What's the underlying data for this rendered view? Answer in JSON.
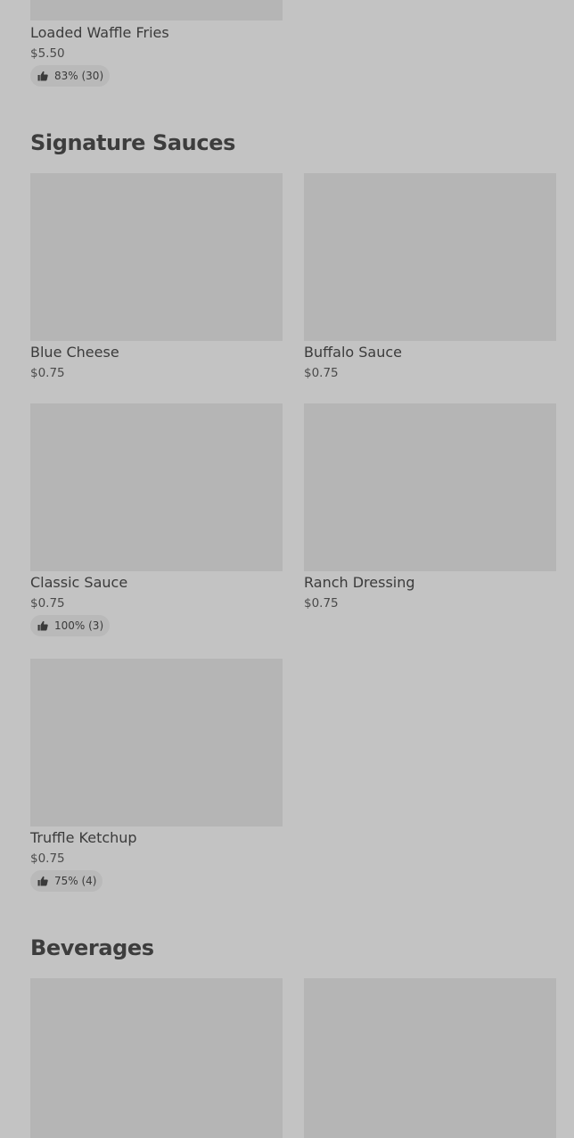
{
  "sections": [
    {
      "title": "",
      "items": [
        {
          "name": "Loaded Waffle Fries",
          "price": "$5.50",
          "rating": "83% (30)",
          "rating_icon": "thumbs-up-icon"
        }
      ]
    },
    {
      "title": "Signature Sauces",
      "items": [
        {
          "name": "Blue Cheese",
          "price": "$0.75"
        },
        {
          "name": "Buffalo Sauce",
          "price": "$0.75"
        },
        {
          "name": "Classic Sauce",
          "price": "$0.75",
          "rating": "100% (3)",
          "rating_icon": "thumbs-up-icon"
        },
        {
          "name": "Ranch Dressing",
          "price": "$0.75"
        },
        {
          "name": "Truffle Ketchup",
          "price": "$0.75",
          "rating": "75% (4)",
          "rating_icon": "thumbs-up-icon"
        }
      ]
    },
    {
      "title": "Beverages",
      "items": []
    }
  ],
  "colors": {
    "background": "#c3c3c3",
    "image_placeholder": "#b5b5b5",
    "rating_pill": "#b9b9b9",
    "text": "#3b3b3b"
  }
}
